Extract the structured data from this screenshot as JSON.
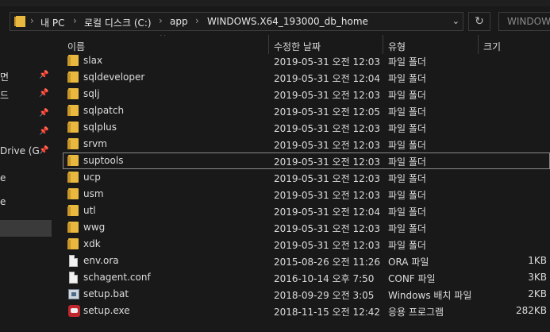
{
  "address": {
    "crumbs": [
      "내 PC",
      "로컬 디스크 (C:)",
      "app",
      "WINDOWS.X64_193000_db_home"
    ],
    "separator": "›",
    "search_placeholder": "WINDOW"
  },
  "nav": {
    "items": [
      {
        "label": "면",
        "pinned": true
      },
      {
        "label": "드",
        "pinned": true
      },
      {
        "label": "",
        "pinned": true
      },
      {
        "label": "",
        "pinned": true
      },
      {
        "label": "Drive (G",
        "pinned": true
      },
      {
        "label": "e",
        "pinned": false
      },
      {
        "label": "e",
        "pinned": false
      },
      {
        "label": "",
        "pinned": false
      }
    ]
  },
  "columns": {
    "name": "이름",
    "date": "수정한 날짜",
    "type": "유형",
    "size": "크기"
  },
  "files": [
    {
      "name": "slax",
      "date": "2019-05-31 오전 12:03",
      "type": "파일 폴더",
      "size": "",
      "icon": "folder-icon"
    },
    {
      "name": "sqldeveloper",
      "date": "2019-05-31 오전 12:04",
      "type": "파일 폴더",
      "size": "",
      "icon": "folder-icon"
    },
    {
      "name": "sqlj",
      "date": "2019-05-31 오전 12:03",
      "type": "파일 폴더",
      "size": "",
      "icon": "folder-icon"
    },
    {
      "name": "sqlpatch",
      "date": "2019-05-31 오전 12:05",
      "type": "파일 폴더",
      "size": "",
      "icon": "folder-icon"
    },
    {
      "name": "sqlplus",
      "date": "2019-05-31 오전 12:03",
      "type": "파일 폴더",
      "size": "",
      "icon": "folder-icon"
    },
    {
      "name": "srvm",
      "date": "2019-05-31 오전 12:03",
      "type": "파일 폴더",
      "size": "",
      "icon": "folder-icon"
    },
    {
      "name": "suptools",
      "date": "2019-05-31 오전 12:03",
      "type": "파일 폴더",
      "size": "",
      "icon": "folder-icon"
    },
    {
      "name": "ucp",
      "date": "2019-05-31 오전 12:03",
      "type": "파일 폴더",
      "size": "",
      "icon": "folder-icon"
    },
    {
      "name": "usm",
      "date": "2019-05-31 오전 12:03",
      "type": "파일 폴더",
      "size": "",
      "icon": "folder-icon"
    },
    {
      "name": "utl",
      "date": "2019-05-31 오전 12:04",
      "type": "파일 폴더",
      "size": "",
      "icon": "folder-icon"
    },
    {
      "name": "wwg",
      "date": "2019-05-31 오전 12:03",
      "type": "파일 폴더",
      "size": "",
      "icon": "folder-icon"
    },
    {
      "name": "xdk",
      "date": "2019-05-31 오전 12:03",
      "type": "파일 폴더",
      "size": "",
      "icon": "folder-icon"
    },
    {
      "name": "env.ora",
      "date": "2015-08-26 오전 11:26",
      "type": "ORA 파일",
      "size": "1KB",
      "icon": "document-icon"
    },
    {
      "name": "schagent.conf",
      "date": "2016-10-14 오후 7:50",
      "type": "CONF 파일",
      "size": "3KB",
      "icon": "document-icon"
    },
    {
      "name": "setup.bat",
      "date": "2018-09-29 오전 3:05",
      "type": "Windows 배치 파일",
      "size": "2KB",
      "icon": "batch-file-icon"
    },
    {
      "name": "setup.exe",
      "date": "2018-11-15 오전 12:42",
      "type": "응용 프로그램",
      "size": "282KB",
      "icon": "oracle-setup-icon"
    }
  ],
  "focused_index": 6
}
